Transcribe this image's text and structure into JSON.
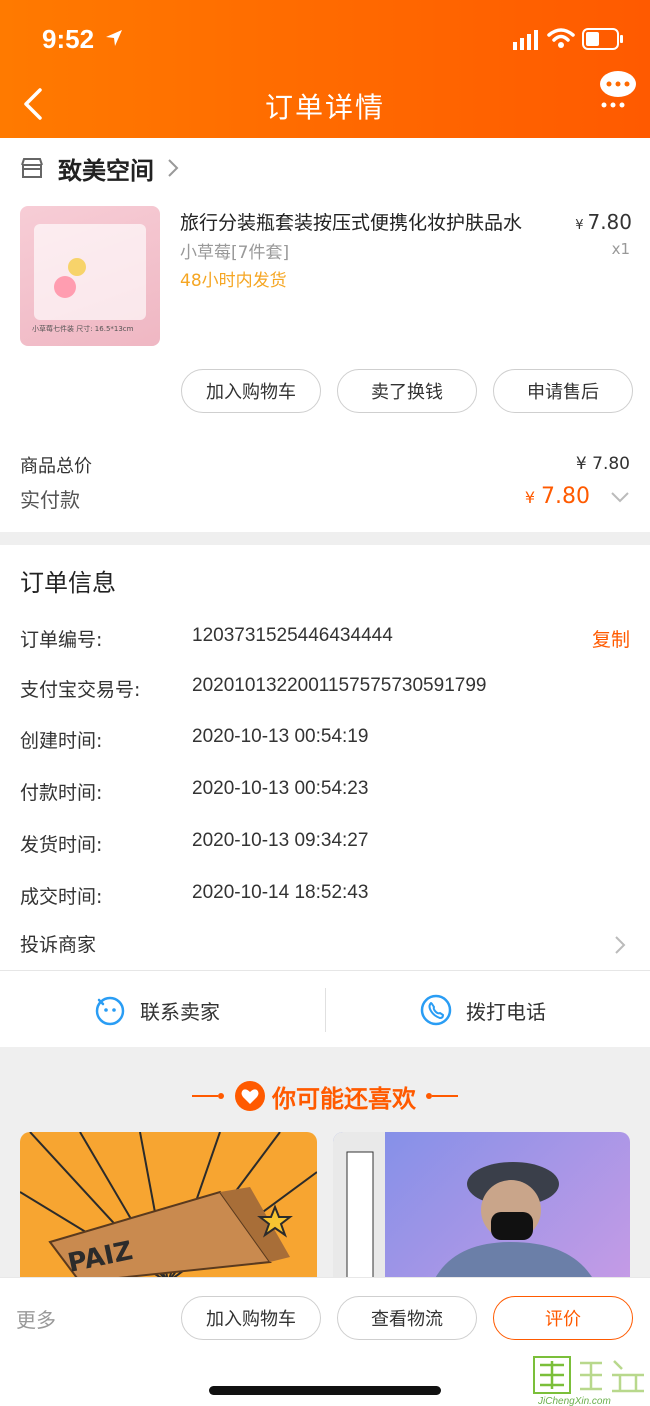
{
  "status_bar": {
    "time": "9:52"
  },
  "nav": {
    "title": "订单详情"
  },
  "shop": {
    "name": "致美空间"
  },
  "product": {
    "title": "旅行分装瓶套装按压式便携化妆护肤品水",
    "variant": "小草莓[7件套]",
    "shipping": "48小时内发货",
    "price_currency": "¥",
    "price": "7.80",
    "qty": "x1",
    "thumb_caption": "小草莓七件装  尺寸: 16.5*13cm"
  },
  "actions": {
    "add_cart": "加入购物车",
    "resell": "卖了换钱",
    "after_sale": "申请售后"
  },
  "summary": {
    "total_label": "商品总价",
    "total_value": "¥ 7.80",
    "paid_label": "实付款",
    "paid_currency": "¥",
    "paid_value": "7.80"
  },
  "order_info": {
    "title": "订单信息",
    "copy_label": "复制",
    "rows": [
      {
        "key": "订单编号:",
        "value": "1203731525446434444"
      },
      {
        "key": "支付宝交易号:",
        "value": "2020101322001157575730591799"
      },
      {
        "key": "创建时间:",
        "value": "2020-10-13 00:54:19"
      },
      {
        "key": "付款时间:",
        "value": "2020-10-13 00:54:23"
      },
      {
        "key": "发货时间:",
        "value": "2020-10-13 09:34:27"
      },
      {
        "key": "成交时间:",
        "value": "2020-10-14 18:52:43"
      }
    ],
    "complain_label": "投诉商家",
    "contact_seller": "联系卖家",
    "call_phone": "拨打电话"
  },
  "recommend": {
    "title": "你可能还喜欢"
  },
  "bottom_bar": {
    "more": "更多",
    "add_cart": "加入购物车",
    "logistics": "查看物流",
    "review": "评价"
  },
  "watermark": {
    "text": "JiChengXin.com"
  },
  "colors": {
    "accent": "#ff5a00",
    "header_start": "#ff7a00",
    "ship_note": "#f5a623"
  },
  "icons": [
    "location-arrow-icon",
    "signal-icon",
    "wifi-icon",
    "battery-icon",
    "back-icon",
    "chat-bubble-icon",
    "shop-icon",
    "chevron-right-icon",
    "chevron-down-icon",
    "smiley-chat-icon",
    "phone-icon",
    "heart-icon"
  ]
}
